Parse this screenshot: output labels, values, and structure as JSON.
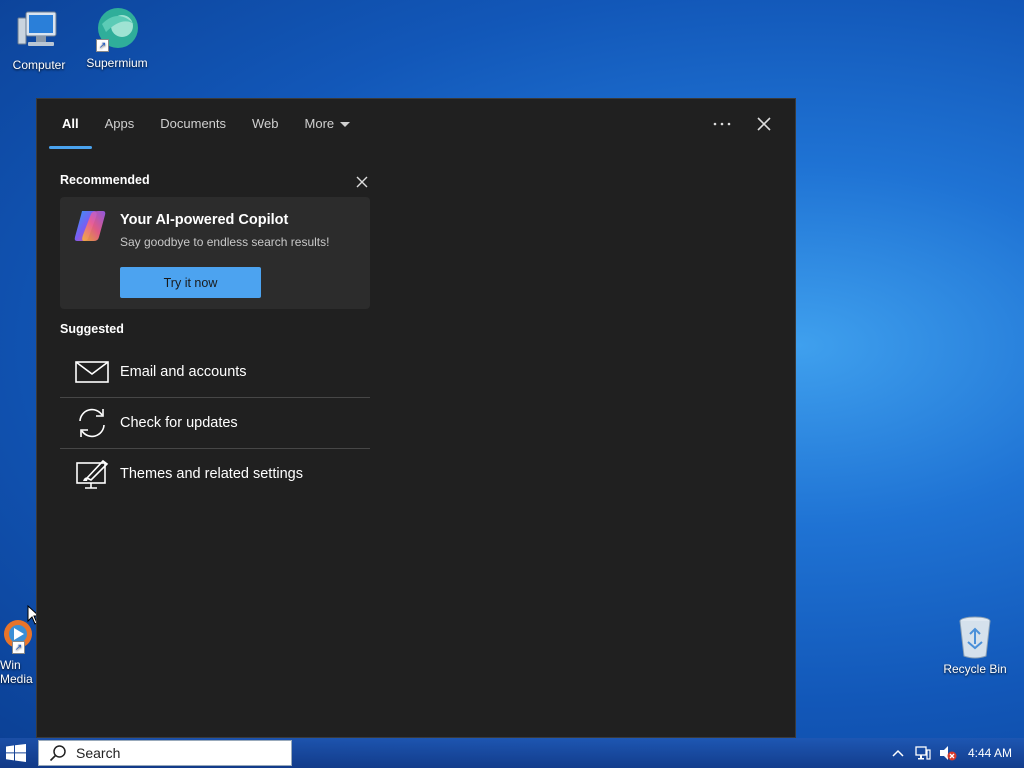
{
  "desktop": {
    "icons": [
      {
        "label": "Computer"
      },
      {
        "label": "Supermium"
      },
      {
        "label": "Windows Media Player",
        "visible_fragment_1": "Win",
        "visible_fragment_2": "Media"
      },
      {
        "label": "Recycle Bin"
      }
    ]
  },
  "search_panel": {
    "tabs": [
      {
        "label": "All",
        "active": true
      },
      {
        "label": "Apps"
      },
      {
        "label": "Documents"
      },
      {
        "label": "Web"
      },
      {
        "label": "More"
      }
    ],
    "more_options_icon": "ellipsis-icon",
    "close_icon": "close-icon",
    "recommended": {
      "title": "Recommended",
      "card": {
        "title": "Your AI-powered Copilot",
        "subtitle": "Say goodbye to endless search results!",
        "button": "Try it now"
      }
    },
    "suggested": {
      "title": "Suggested",
      "items": [
        {
          "label": "Email and accounts",
          "icon": "mail-icon"
        },
        {
          "label": "Check for updates",
          "icon": "sync-icon"
        },
        {
          "label": "Themes and related settings",
          "icon": "theme-brush-icon"
        }
      ]
    }
  },
  "taskbar": {
    "search_placeholder": "Search",
    "clock": "4:44 AM",
    "tray_icons": [
      "show-hidden-icons-icon",
      "network-icon",
      "volume-muted-icon"
    ]
  },
  "colors": {
    "accent": "#4ca3f0",
    "panel_bg": "#202020",
    "card_bg": "#2c2c2c"
  }
}
